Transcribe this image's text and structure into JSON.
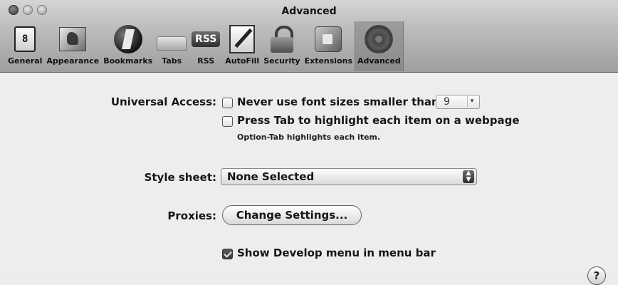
{
  "window": {
    "title": "Advanced"
  },
  "toolbar": {
    "items": [
      {
        "label": "General",
        "icon": "general-icon"
      },
      {
        "label": "Appearance",
        "icon": "appearance-icon"
      },
      {
        "label": "Bookmarks",
        "icon": "bookmarks-icon"
      },
      {
        "label": "Tabs",
        "icon": "tabs-icon"
      },
      {
        "label": "RSS",
        "icon": "rss-icon",
        "badge": "RSS"
      },
      {
        "label": "AutoFill",
        "icon": "autofill-icon"
      },
      {
        "label": "Security",
        "icon": "lock-icon"
      },
      {
        "label": "Extensions",
        "icon": "extensions-icon"
      },
      {
        "label": "Advanced",
        "icon": "gear-icon",
        "selected": true
      }
    ],
    "general_glyph": "8"
  },
  "universal_access": {
    "label": "Universal Access:",
    "min_font": {
      "label": "Never use font sizes smaller than",
      "checked": false,
      "value": "9"
    },
    "tab_highlight": {
      "label": "Press Tab to highlight each item on a webpage",
      "checked": false,
      "hint": "Option-Tab highlights each item."
    }
  },
  "style_sheet": {
    "label": "Style sheet:",
    "value": "None Selected"
  },
  "proxies": {
    "label": "Proxies:",
    "button": "Change Settings..."
  },
  "develop_menu": {
    "label": "Show Develop menu in menu bar",
    "checked": true
  },
  "help": {
    "glyph": "?"
  }
}
